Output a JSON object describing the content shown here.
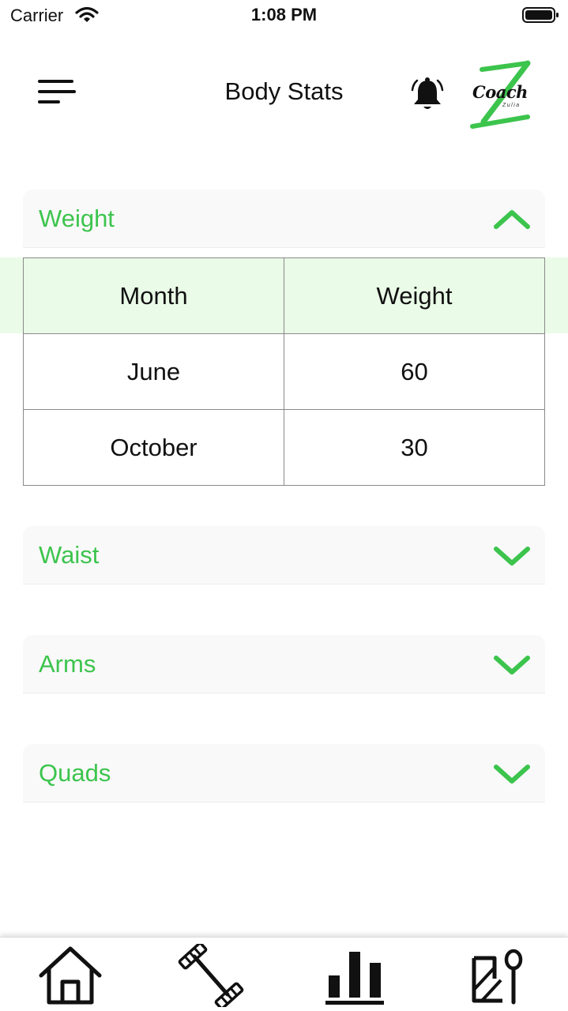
{
  "status_bar": {
    "carrier": "Carrier",
    "time": "1:08 PM"
  },
  "header": {
    "title": "Body Stats",
    "menu_icon": "hamburger-menu-icon",
    "notification_icon": "bell-icon",
    "logo": {
      "text": "Coach",
      "subtext": "Zulia",
      "letter": "Z"
    }
  },
  "sections": [
    {
      "label": "Weight",
      "expanded": true,
      "chevron": "chevron-up-icon"
    },
    {
      "label": "Waist",
      "expanded": false,
      "chevron": "chevron-down-icon"
    },
    {
      "label": "Arms",
      "expanded": false,
      "chevron": "chevron-down-icon"
    },
    {
      "label": "Quads",
      "expanded": false,
      "chevron": "chevron-down-icon"
    }
  ],
  "weight_table": {
    "headers": [
      "Month",
      "Weight"
    ],
    "rows": [
      [
        "June",
        "60"
      ],
      [
        "October",
        "30"
      ]
    ]
  },
  "tab_bar": {
    "tabs": [
      {
        "name": "home",
        "icon": "home-icon",
        "active": false
      },
      {
        "name": "workouts",
        "icon": "barbell-icon",
        "active": false
      },
      {
        "name": "stats",
        "icon": "bar-chart-icon",
        "active": true
      },
      {
        "name": "nutrition",
        "icon": "nutrition-icon",
        "active": false
      }
    ]
  },
  "colors": {
    "accent": "#3cc44d",
    "header_row_bg": "#eafbe7",
    "section_bg": "#f9f9f9"
  }
}
